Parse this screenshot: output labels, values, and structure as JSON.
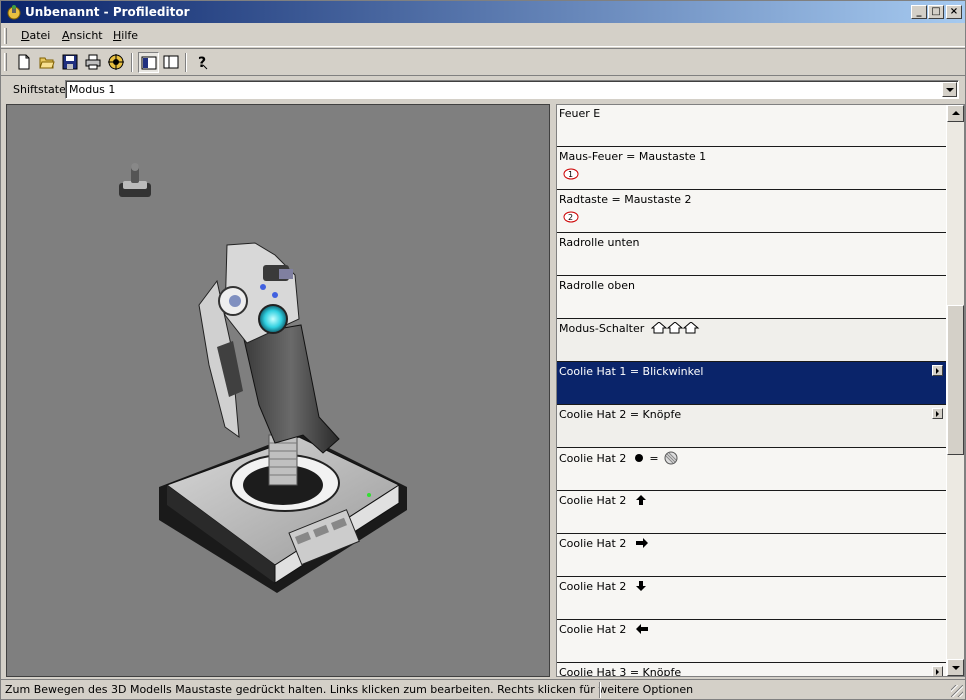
{
  "window": {
    "title": "Unbenannt - Profileditor",
    "controls": {
      "minimize": "_",
      "maximize": "□",
      "close": "×"
    }
  },
  "menu": [
    {
      "key": "D",
      "rest": "atei"
    },
    {
      "key": "A",
      "rest": "nsicht"
    },
    {
      "key": "H",
      "rest": "ilfe"
    }
  ],
  "toolbar": [
    "new-file-icon",
    "open-folder-icon",
    "save-icon",
    "print-icon",
    "target-icon",
    "view-split-left-icon",
    "view-split-right-icon",
    "help-icon"
  ],
  "shiftstate": {
    "label": "Shiftstate",
    "value": "Modus 1"
  },
  "list": [
    {
      "label": "Feuer E",
      "sub": ""
    },
    {
      "label": "Maus-Feuer = Maustaste 1",
      "sub": "mouse-1"
    },
    {
      "label": "Radtaste = Maustaste 2",
      "sub": "mouse-2"
    },
    {
      "label": "Radrolle unten",
      "sub": ""
    },
    {
      "label": "Radrolle oben",
      "sub": ""
    },
    {
      "label": "Modus-Schalter",
      "sub": ""
    },
    {
      "label": "Coolie Hat 1 = Blickwinkel",
      "sub": ""
    },
    {
      "label": "Coolie Hat 2 = Knöpfe",
      "sub": ""
    },
    {
      "label": "Coolie Hat 2",
      "sub": ""
    },
    {
      "label": "Coolie Hat 2",
      "sub": ""
    },
    {
      "label": "Coolie Hat 2",
      "sub": ""
    },
    {
      "label": "Coolie Hat 2",
      "sub": ""
    },
    {
      "label": "Coolie Hat 2",
      "sub": ""
    },
    {
      "label": "Coolie Hat 3 = Knöpfe",
      "sub": ""
    }
  ],
  "mouse_badges": {
    "one": "1",
    "two": "2"
  },
  "hat_equals": "=",
  "status": {
    "text": "Zum Bewegen des 3D Modells Maustaste gedrückt halten. Links klicken zum bearbeiten. Rechts klicken für weitere Optionen"
  },
  "colors": {
    "selection": "#0a246a",
    "viewport": "#7f7f7f",
    "title_start": "#0a246a",
    "title_end": "#a6caf0"
  }
}
